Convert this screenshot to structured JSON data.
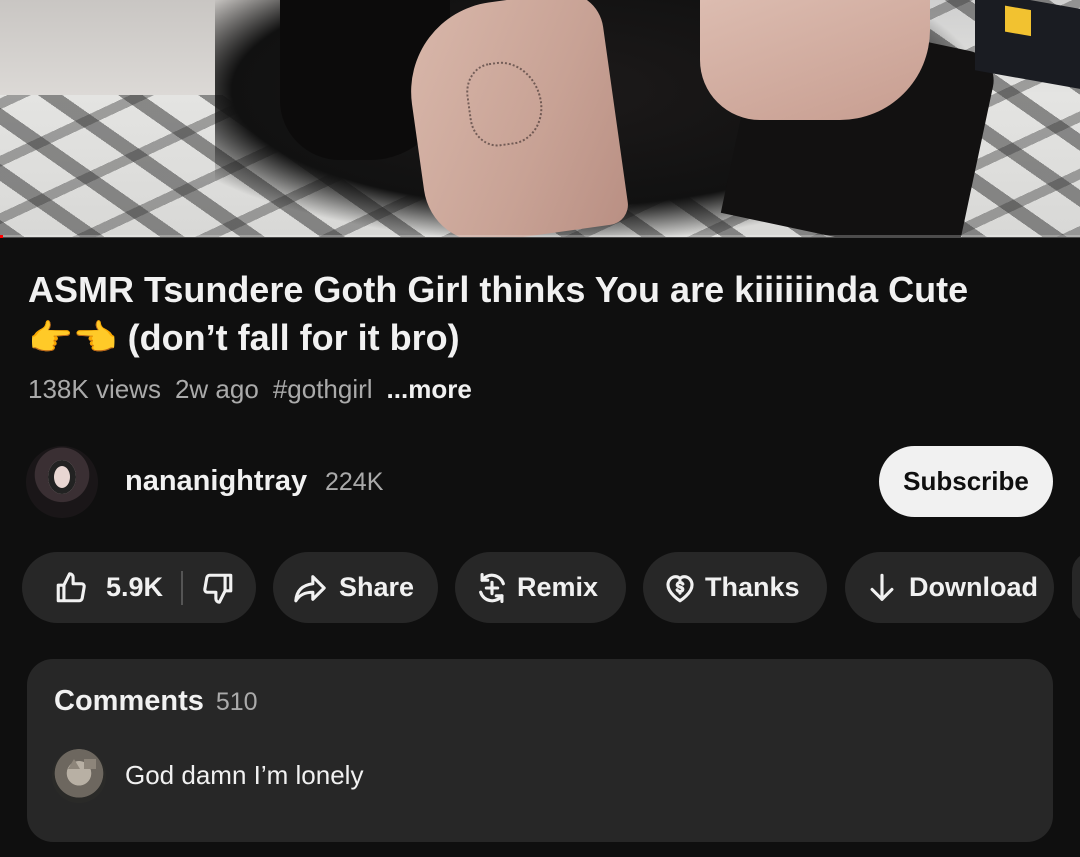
{
  "video": {
    "progress_fraction": 0.003
  },
  "title": {
    "line1": "ASMR Tsundere Goth Girl thinks You are kiiiiiinda Cute",
    "emoji": "👉👈",
    "line2": "(don’t fall for it bro)"
  },
  "meta": {
    "views": "138K views",
    "age": "2w ago",
    "hashtag": "#gothgirl",
    "more": "...more"
  },
  "channel": {
    "name": "nananightray",
    "subscribers": "224K",
    "subscribe_label": "Subscribe"
  },
  "actions": {
    "like_count": "5.9K",
    "share": "Share",
    "remix": "Remix",
    "thanks": "Thanks",
    "download": "Download"
  },
  "comments": {
    "label": "Comments",
    "count": "510",
    "top_comment": "God damn I’m lonely"
  },
  "colors": {
    "background": "#0f0f0f",
    "pill": "#272727",
    "text": "#f1f1f1",
    "secondary_text": "#aaaaaa",
    "subscribe_bg": "#f1f1f1"
  }
}
